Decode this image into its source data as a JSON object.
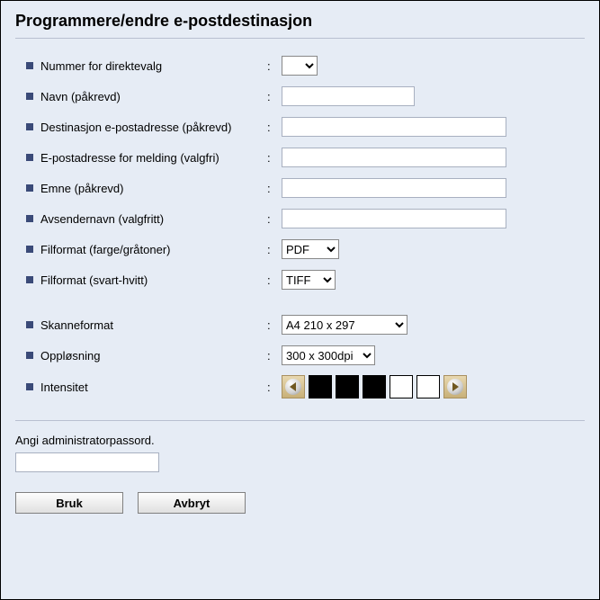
{
  "title": "Programmere/endre e-postdestinasjon",
  "fields": {
    "number": {
      "label": "Nummer for direktevalg"
    },
    "name": {
      "label": "Navn (påkrevd)",
      "value": ""
    },
    "dest_email": {
      "label": "Destinasjon e-postadresse (påkrevd)",
      "value": ""
    },
    "notify_email": {
      "label": "E-postadresse for melding (valgfri)",
      "value": ""
    },
    "subject": {
      "label": "Emne (påkrevd)",
      "value": ""
    },
    "sender": {
      "label": "Avsendernavn (valgfritt)",
      "value": ""
    },
    "file_color": {
      "label": "Filformat (farge/gråtoner)",
      "value": "PDF"
    },
    "file_bw": {
      "label": "Filformat (svart-hvitt)",
      "value": "TIFF"
    },
    "scan_format": {
      "label": "Skanneformat",
      "value": "A4 210 x 297"
    },
    "resolution": {
      "label": "Oppløsning",
      "value": "300 x 300dpi"
    },
    "intensity": {
      "label": "Intensitet"
    }
  },
  "password": {
    "label": "Angi administratorpassord."
  },
  "buttons": {
    "apply": "Bruk",
    "cancel": "Avbryt"
  }
}
